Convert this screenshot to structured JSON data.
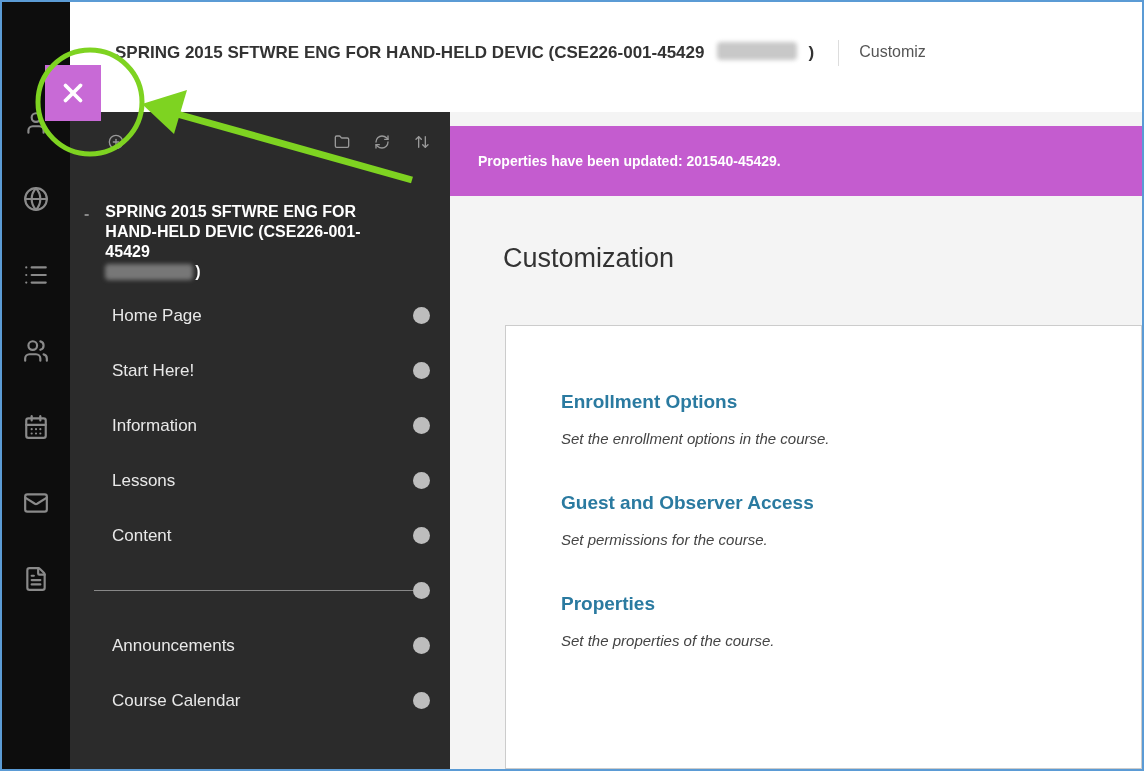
{
  "header": {
    "title": "SPRING 2015 SFTWRE ENG FOR HAND-HELD DEVIC (CSE226-001-45429",
    "title_end": ")",
    "breadcrumb": "Customiz"
  },
  "course_menu": {
    "title": "SPRING 2015 SFTWRE ENG FOR HAND-HELD DEVIC (CSE226-001-45429",
    "title_end": ")",
    "collapse": "-",
    "items": [
      {
        "kind": "link",
        "label": "Home Page"
      },
      {
        "kind": "link",
        "label": "Start Here!"
      },
      {
        "kind": "link",
        "label": "Information"
      },
      {
        "kind": "link",
        "label": "Lessons"
      },
      {
        "kind": "link",
        "label": "Content"
      },
      {
        "kind": "divider"
      },
      {
        "kind": "link",
        "label": "Announcements"
      },
      {
        "kind": "link",
        "label": "Course Calendar"
      }
    ]
  },
  "banner": {
    "message": "Properties have been updated: 201540-45429."
  },
  "page": {
    "heading": "Customization",
    "options": [
      {
        "title": "Enrollment Options",
        "description": "Set the enrollment options in the course."
      },
      {
        "title": "Guest and Observer Access",
        "description": "Set permissions for the course."
      },
      {
        "title": "Properties",
        "description": "Set the properties of the course."
      }
    ]
  }
}
